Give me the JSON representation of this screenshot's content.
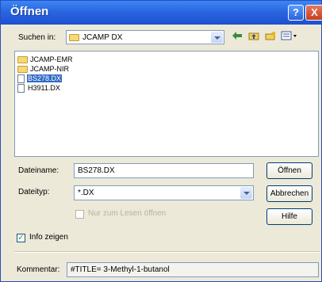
{
  "window": {
    "title": "Öffnen",
    "help_glyph": "?",
    "close_glyph": "X"
  },
  "lookin": {
    "label": "Suchen in:",
    "value": "JCAMP DX"
  },
  "toolbar": {
    "back_icon": "back-arrow-icon",
    "up_icon": "up-folder-icon",
    "newfolder_icon": "new-folder-icon",
    "views_icon": "views-menu-icon"
  },
  "files": [
    {
      "name": "JCAMP-EMR",
      "type": "folder",
      "selected": false
    },
    {
      "name": "JCAMP-NIR",
      "type": "folder",
      "selected": false
    },
    {
      "name": "BS278.DX",
      "type": "file",
      "selected": true
    },
    {
      "name": "H3911.DX",
      "type": "file",
      "selected": false
    }
  ],
  "filename": {
    "label": "Dateiname:",
    "value": "BS278.DX"
  },
  "filetype": {
    "label": "Dateityp:",
    "value": "*.DX"
  },
  "readonly": {
    "label": "Nur zum Lesen öffnen",
    "checked": false
  },
  "buttons": {
    "open": "Öffnen",
    "cancel": "Abbrechen",
    "help": "Hilfe"
  },
  "info": {
    "label": "Info zeigen",
    "checked": true,
    "mark": "✓"
  },
  "comment": {
    "label": "Kommentar:",
    "value": "#TITLE= 3-Methyl-1-butanol"
  }
}
